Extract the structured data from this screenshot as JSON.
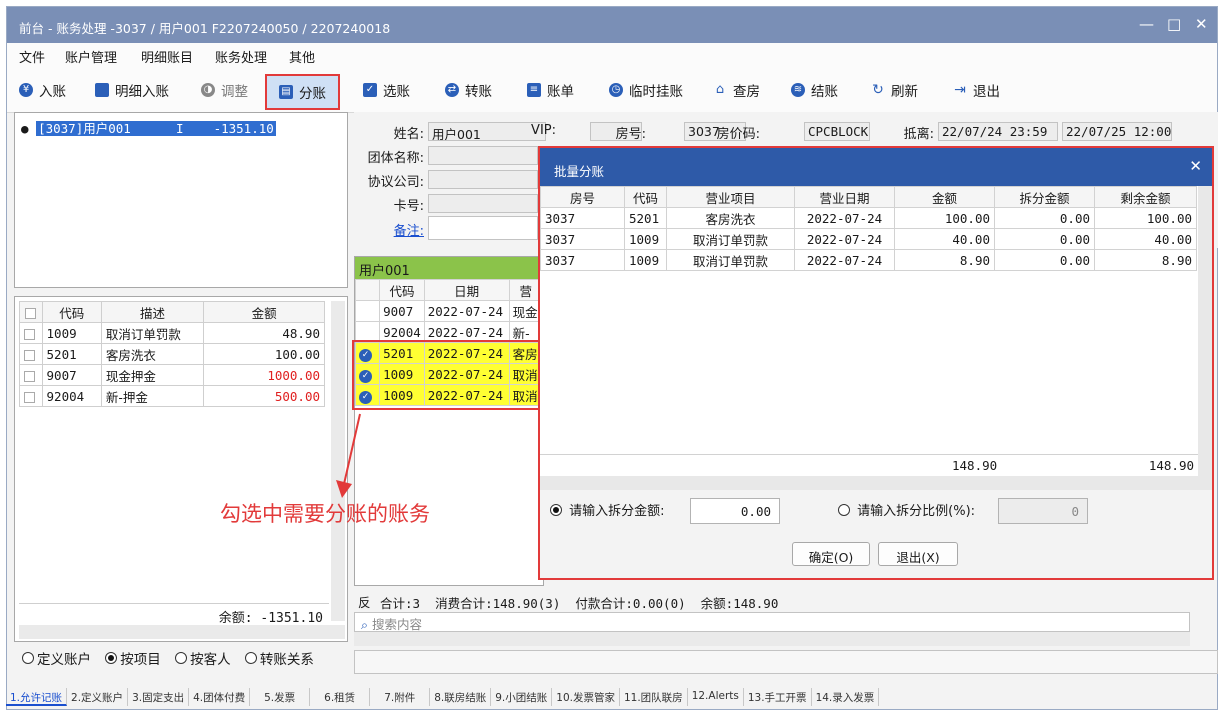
{
  "window": {
    "title": "前台 - 账务处理 -3037 / 用户001 F2207240050 / 2207240018",
    "controls": {
      "minimize": "—",
      "maximize": "□",
      "close": "✕"
    }
  },
  "menu": [
    "文件",
    "账户管理",
    "明细账目",
    "账务处理",
    "其他"
  ],
  "toolbar": [
    {
      "label": "入账",
      "icon": "yen-icon"
    },
    {
      "label": "明细入账",
      "icon": "card-icon"
    },
    {
      "label": "调整",
      "icon": "adjust-icon"
    },
    {
      "label": "分账",
      "icon": "split-icon",
      "highlighted": true
    },
    {
      "label": "选账",
      "icon": "select-icon"
    },
    {
      "label": "转账",
      "icon": "transfer-icon"
    },
    {
      "label": "账单",
      "icon": "bill-icon"
    },
    {
      "label": "临时挂账",
      "icon": "clock-icon"
    },
    {
      "label": "查房",
      "icon": "house-icon"
    },
    {
      "label": "结账",
      "icon": "stack-icon"
    },
    {
      "label": "刷新",
      "icon": "refresh-icon"
    },
    {
      "label": "退出",
      "icon": "exit-icon"
    }
  ],
  "tree": {
    "selected": "[3037]用户001      I    -1351.10"
  },
  "left_table": {
    "headers": [
      "代码",
      "描述",
      "金额"
    ],
    "rows": [
      {
        "code": "1009",
        "desc": "取消订单罚款",
        "amount": "48.90",
        "color": "#1a1a1a"
      },
      {
        "code": "5201",
        "desc": "客房洗衣",
        "amount": "100.00",
        "color": "#1a1a1a"
      },
      {
        "code": "9007",
        "desc": "现金押金",
        "amount": "1000.00",
        "color": "#e02020"
      },
      {
        "code": "92004",
        "desc": "新-押金",
        "amount": "500.00",
        "color": "#e02020"
      }
    ],
    "balance": "余额: -1351.10"
  },
  "radios": [
    {
      "label": "定义账户",
      "checked": false
    },
    {
      "label": "按项目",
      "checked": true
    },
    {
      "label": "按客人",
      "checked": false
    },
    {
      "label": "转账关系",
      "checked": false
    }
  ],
  "info": {
    "name_label": "姓名:",
    "name": "用户001",
    "vip_label": "VIP:",
    "vip": "",
    "room_label": "房号:",
    "room": "3037",
    "rate_label": "房价码:",
    "rate": "CPCBLOCK",
    "arrive_label": "抵离:",
    "arrive": "22/07/24 23:59",
    "depart": "22/07/25 12:00",
    "group_label": "团体名称:",
    "agreement_label": "协议公司:",
    "card_label": "卡号:",
    "note_label": "备注:"
  },
  "account": {
    "header": "用户001",
    "cols": [
      "代码",
      "日期",
      "营"
    ],
    "rows": [
      {
        "code": "9007",
        "date": "2022-07-24",
        "item": "现金",
        "selected": false
      },
      {
        "code": "92004",
        "date": "2022-07-24",
        "item": "新-",
        "selected": false
      },
      {
        "code": "5201",
        "date": "2022-07-24",
        "item": "客房",
        "selected": true
      },
      {
        "code": "1009",
        "date": "2022-07-24",
        "item": "取消",
        "selected": true
      },
      {
        "code": "1009",
        "date": "2022-07-24",
        "item": "取消",
        "selected": true
      }
    ],
    "footer_prefix": "反",
    "footer": "合计:3  消费合计:148.90(3)  付款合计:0.00(0)  余额:148.90",
    "search_placeholder": "搜索内容"
  },
  "annotation": "勾选中需要分账的账务",
  "dialog": {
    "title": "批量分账",
    "close": "✕",
    "headers": [
      "房号",
      "代码",
      "营业项目",
      "营业日期",
      "金额",
      "拆分金额",
      "剩余金额"
    ],
    "rows": [
      [
        "3037",
        "5201",
        "客房洗衣",
        "2022-07-24",
        "100.00",
        "0.00",
        "100.00"
      ],
      [
        "3037",
        "1009",
        "取消订单罚款",
        "2022-07-24",
        "40.00",
        "0.00",
        "40.00"
      ],
      [
        "3037",
        "1009",
        "取消订单罚款",
        "2022-07-24",
        "8.90",
        "0.00",
        "8.90"
      ]
    ],
    "total_amount": "148.90",
    "total_remaining": "148.90",
    "opt_amount_label": "请输入拆分金额:",
    "opt_amount_value": "0.00",
    "opt_ratio_label": "请输入拆分比例(%):",
    "opt_ratio_value": "0",
    "confirm": "确定(O)",
    "exit": "退出(X)"
  },
  "tabs": [
    "1.允许记账",
    "2.定义账户",
    "3.固定支出",
    "4.团体付费",
    "5.发票",
    "6.租赁",
    "7.附件",
    "8.联房结账",
    "9.小团结账",
    "10.发票管家",
    "11.团队联房",
    "12.Alerts",
    "13.手工开票",
    "14.录入发票"
  ]
}
